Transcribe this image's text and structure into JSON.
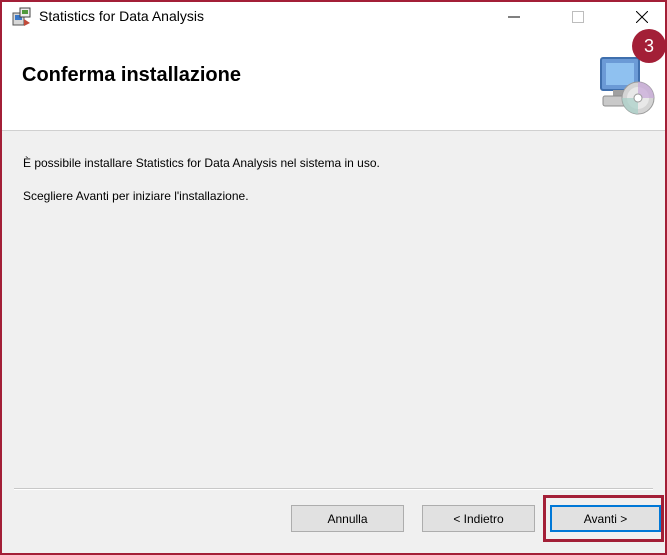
{
  "window": {
    "title": "Statistics for Data Analysis",
    "controls": {
      "minimize": "minimize-icon",
      "maximize": "maximize-icon",
      "close": "close-icon"
    }
  },
  "header": {
    "title": "Conferma installazione",
    "icon": "setup-computer-disc-icon"
  },
  "annotation": {
    "step": "3",
    "color": "#a31f37"
  },
  "content": {
    "message1": "È possibile installare Statistics for Data Analysis nel sistema in uso.",
    "message2": "Scegliere Avanti per iniziare l'installazione."
  },
  "buttons": {
    "cancel": "Annulla",
    "back": "< Indietro",
    "next": "Avanti >"
  }
}
